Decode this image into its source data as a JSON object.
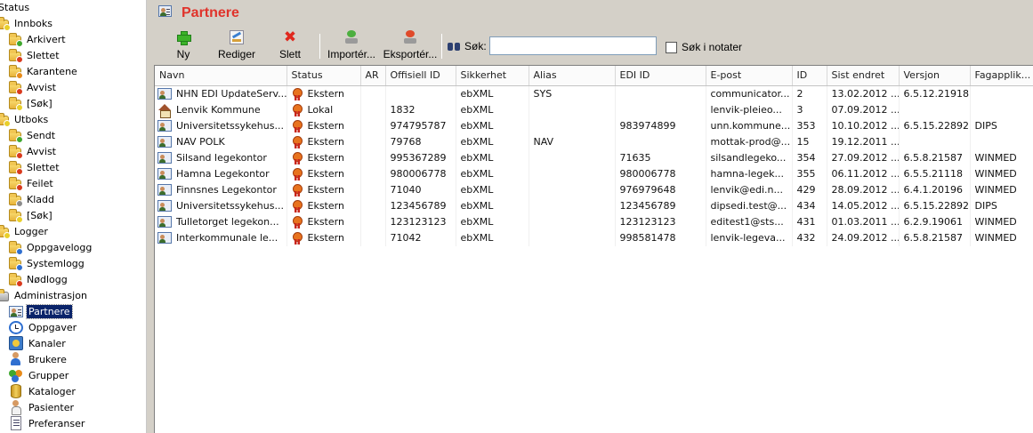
{
  "sidebar": {
    "root_label": "Status",
    "items": [
      {
        "label": "Innboks",
        "icon": "folder-icon",
        "badge": "yellow",
        "level": 0
      },
      {
        "label": "Arkivert",
        "icon": "folder-archived-icon",
        "badge": "green",
        "level": 1
      },
      {
        "label": "Slettet",
        "icon": "folder-deleted-icon",
        "badge": "red",
        "level": 1
      },
      {
        "label": "Karantene",
        "icon": "folder-quarantine-icon",
        "badge": "orange",
        "level": 1
      },
      {
        "label": "Avvist",
        "icon": "folder-rejected-icon",
        "badge": "red",
        "level": 1
      },
      {
        "label": "[Søk]",
        "icon": "folder-search-icon",
        "badge": "yellow",
        "level": 1
      },
      {
        "label": "Utboks",
        "icon": "folder-icon",
        "badge": "yellow",
        "level": 0
      },
      {
        "label": "Sendt",
        "icon": "folder-sent-icon",
        "badge": "green",
        "level": 1
      },
      {
        "label": "Avvist",
        "icon": "folder-rejected-icon",
        "badge": "red",
        "level": 1
      },
      {
        "label": "Slettet",
        "icon": "folder-deleted-icon",
        "badge": "red",
        "level": 1
      },
      {
        "label": "Feilet",
        "icon": "folder-failed-icon",
        "badge": "red",
        "level": 1
      },
      {
        "label": "Kladd",
        "icon": "folder-draft-icon",
        "badge": "gray",
        "level": 1
      },
      {
        "label": "[Søk]",
        "icon": "folder-search-icon",
        "badge": "yellow",
        "level": 1
      },
      {
        "label": "Logger",
        "icon": "folder-icon",
        "badge": "yellow",
        "level": 0
      },
      {
        "label": "Oppgavelogg",
        "icon": "folder-tasklog-icon",
        "badge": "blue",
        "level": 1
      },
      {
        "label": "Systemlogg",
        "icon": "folder-syslog-icon",
        "badge": "blue",
        "level": 1
      },
      {
        "label": "Nødlogg",
        "icon": "folder-emergencylog-icon",
        "badge": "red",
        "level": 1
      },
      {
        "label": "Administrasjon",
        "icon": "admin-icon",
        "badge": "",
        "level": 0
      },
      {
        "label": "Partnere",
        "icon": "partner-icon",
        "badge": "",
        "level": 1,
        "selected": true
      },
      {
        "label": "Oppgaver",
        "icon": "clock-icon",
        "badge": "",
        "level": 1
      },
      {
        "label": "Kanaler",
        "icon": "channel-icon",
        "badge": "",
        "level": 1
      },
      {
        "label": "Brukere",
        "icon": "user-icon",
        "badge": "",
        "level": 1
      },
      {
        "label": "Grupper",
        "icon": "group-icon",
        "badge": "",
        "level": 1
      },
      {
        "label": "Kataloger",
        "icon": "database-icon",
        "badge": "",
        "level": 1
      },
      {
        "label": "Pasienter",
        "icon": "patient-icon",
        "badge": "",
        "level": 1
      },
      {
        "label": "Preferanser",
        "icon": "document-icon",
        "badge": "",
        "level": 1
      }
    ]
  },
  "header": {
    "title": "Partnere"
  },
  "toolbar": {
    "new_label": "Ny",
    "edit_label": "Rediger",
    "delete_label": "Slett",
    "import_label": "Importér...",
    "export_label": "Eksportér...",
    "search_label": "Søk:",
    "search_value": "",
    "notes_label": "Søk i notater",
    "notes_checked": false
  },
  "grid": {
    "columns": [
      "Navn",
      "Status",
      "AR",
      "Offisiell ID",
      "Sikkerhet",
      "Alias",
      "EDI ID",
      "E-post",
      "ID",
      "Sist endret",
      "Versjon",
      "Fagapplik..."
    ],
    "rows": [
      {
        "icon": "partner",
        "cells": [
          "NHN EDI UpdateServ...",
          "Ekstern",
          "",
          "",
          "ebXML",
          "SYS",
          "",
          "communicator...",
          "2",
          "13.02.2012 ...",
          "6.5.12.21918",
          ""
        ]
      },
      {
        "icon": "house",
        "cells": [
          "Lenvik Kommune",
          "Lokal",
          "",
          "1832",
          "ebXML",
          "",
          "",
          "lenvik-pleieo...",
          "3",
          "07.09.2012 ...",
          "",
          ""
        ]
      },
      {
        "icon": "partner",
        "cells": [
          "Universitetssykehus...",
          "Ekstern",
          "",
          "974795787",
          "ebXML",
          "",
          "983974899",
          "unn.kommune...",
          "353",
          "10.10.2012 ...",
          "6.5.15.22892",
          "DIPS"
        ]
      },
      {
        "icon": "partner",
        "cells": [
          "NAV POLK",
          "Ekstern",
          "",
          "79768",
          "ebXML",
          "NAV",
          "",
          "mottak-prod@...",
          "15",
          "19.12.2011 ...",
          "",
          ""
        ]
      },
      {
        "icon": "partner",
        "cells": [
          "Silsand legekontor",
          "Ekstern",
          "",
          "995367289",
          "ebXML",
          "",
          "71635",
          "silsandlegeko...",
          "354",
          "27.09.2012 ...",
          "6.5.8.21587",
          "WINMED"
        ]
      },
      {
        "icon": "partner",
        "cells": [
          "Hamna Legekontor",
          "Ekstern",
          "",
          "980006778",
          "ebXML",
          "",
          "980006778",
          "hamna-legek...",
          "355",
          "06.11.2012 ...",
          "6.5.5.21118",
          "WINMED"
        ]
      },
      {
        "icon": "partner",
        "cells": [
          "Finnsnes Legekontor",
          "Ekstern",
          "",
          "71040",
          "ebXML",
          "",
          "976979648",
          "lenvik@edi.n...",
          "429",
          "28.09.2012 ...",
          "6.4.1.20196",
          "WINMED"
        ]
      },
      {
        "icon": "partner",
        "cells": [
          "Universitetssykehus...",
          "Ekstern",
          "",
          "123456789",
          "ebXML",
          "",
          "123456789",
          "dipsedi.test@...",
          "434",
          "14.05.2012 ...",
          "6.5.15.22892",
          "DIPS"
        ]
      },
      {
        "icon": "partner",
        "cells": [
          "Tulletorget legekon...",
          "Ekstern",
          "",
          "123123123",
          "ebXML",
          "",
          "123123123",
          "editest1@sts...",
          "431",
          "01.03.2011 ...",
          "6.2.9.19061",
          "WINMED"
        ]
      },
      {
        "icon": "partner",
        "cells": [
          "Interkommunale le...",
          "Ekstern",
          "",
          "71042",
          "ebXML",
          "",
          "998581478",
          "lenvik-legeva...",
          "432",
          "24.09.2012 ...",
          "6.5.8.21587",
          "WINMED"
        ]
      }
    ]
  },
  "colors": {
    "title": "#e0332b",
    "panel_bg": "#d4d0c8",
    "selection": "#0a246a"
  }
}
